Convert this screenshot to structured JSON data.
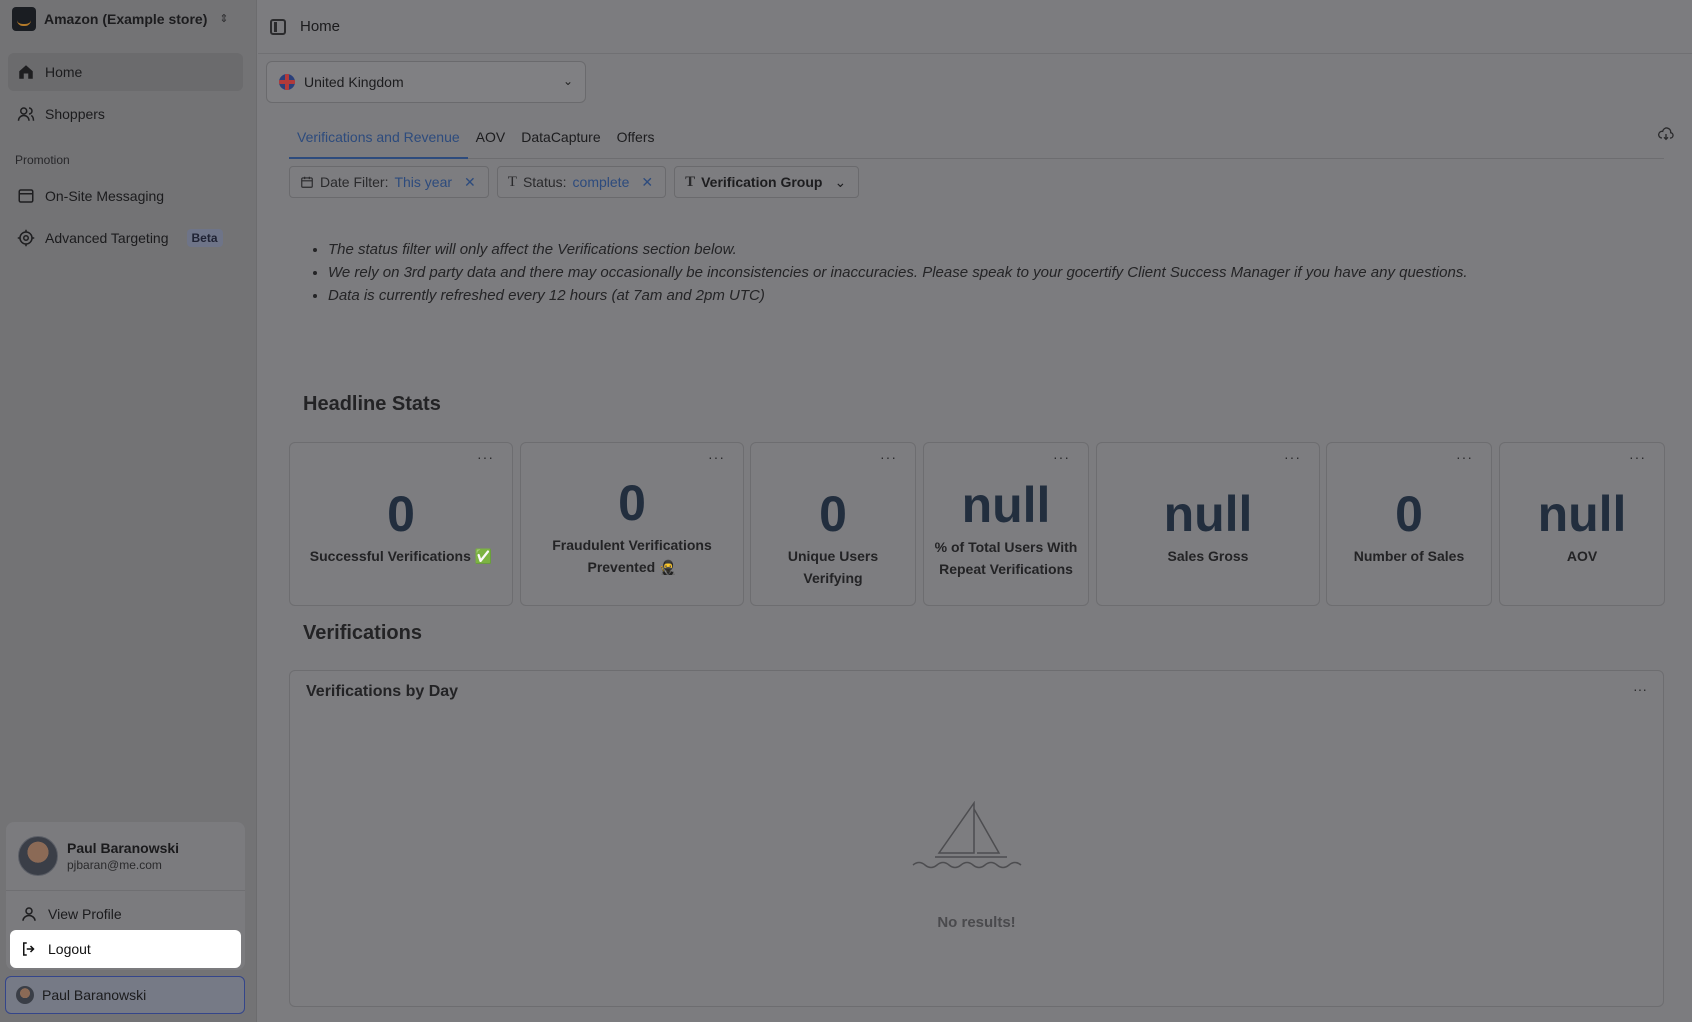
{
  "store": {
    "name": "Amazon (Example store)"
  },
  "sidebar": {
    "items": [
      {
        "label": "Home",
        "icon": "home-icon"
      },
      {
        "label": "Shoppers",
        "icon": "users-icon"
      }
    ],
    "section_label": "Promotion",
    "promo_items": [
      {
        "label": "On-Site Messaging",
        "icon": "window-icon"
      },
      {
        "label": "Advanced Targeting",
        "icon": "target-icon",
        "badge": "Beta"
      }
    ]
  },
  "user_menu": {
    "name": "Paul Baranowski",
    "email": "pjbaran@me.com",
    "view_profile": "View Profile",
    "logout": "Logout"
  },
  "topbar": {
    "breadcrumb": "Home"
  },
  "country": {
    "selected": "United Kingdom"
  },
  "tabs": [
    "Verifications and Revenue",
    "AOV",
    "DataCapture",
    "Offers"
  ],
  "filters": {
    "date": {
      "label": "Date Filter:",
      "value": "This year"
    },
    "status": {
      "label": "Status:",
      "value": "complete"
    },
    "group": {
      "label": "Verification Group"
    }
  },
  "notes": [
    "The status filter will only affect the Verifications section below.",
    "We rely on 3rd party data and there may occasionally be inconsistencies or inaccuracies. Please speak to your gocertify Client Success Manager if you have any questions.",
    "Data is currently refreshed every 12 hours (at 7am and 2pm UTC)"
  ],
  "headline": {
    "title": "Headline Stats",
    "stats": [
      {
        "value": "0",
        "label": "Successful Verifications ✅"
      },
      {
        "value": "0",
        "label": "Fraudulent Verifications Prevented 🥷"
      },
      {
        "value": "0",
        "label": "Unique Users Verifying"
      },
      {
        "value": "null",
        "label": "% of Total Users With Repeat Verifications"
      },
      {
        "value": "null",
        "label": "Sales Gross"
      },
      {
        "value": "0",
        "label": "Number of Sales"
      },
      {
        "value": "null",
        "label": "AOV"
      }
    ],
    "menu": "···"
  },
  "verifications": {
    "title": "Verifications",
    "panel_title": "Verifications by Day",
    "empty_text": "No results!"
  }
}
